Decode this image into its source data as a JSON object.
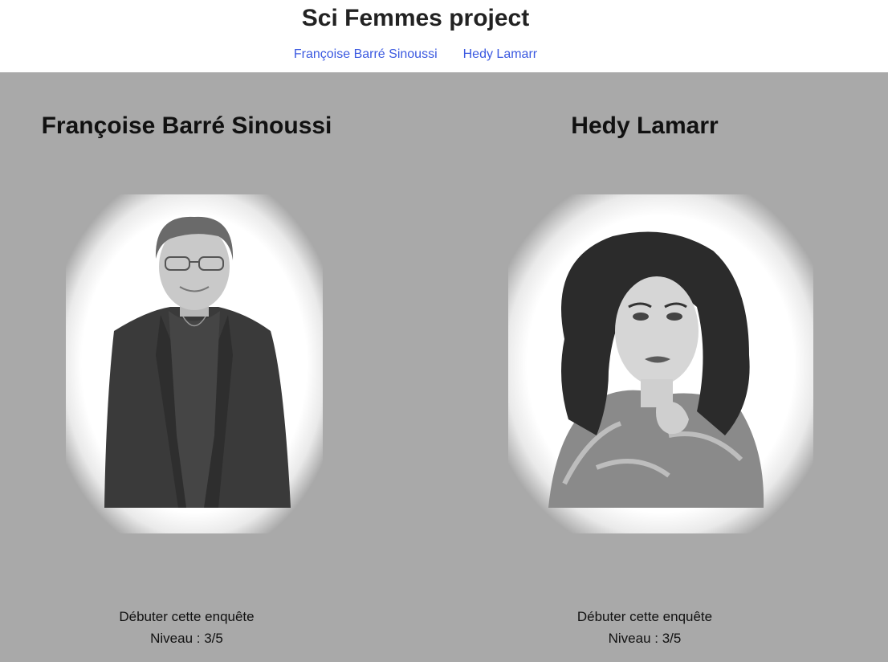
{
  "site": {
    "title": "Sci Femmes project"
  },
  "nav": {
    "items": [
      {
        "label": "Françoise Barré Sinoussi"
      },
      {
        "label": "Hedy Lamarr"
      }
    ]
  },
  "cards": [
    {
      "name": "Françoise Barré Sinoussi",
      "start_label": "Débuter cette enquête",
      "level_label": "Niveau : 3/5"
    },
    {
      "name": "Hedy Lamarr",
      "start_label": "Débuter cette enquête",
      "level_label": "Niveau : 3/5"
    }
  ],
  "colors": {
    "background": "#a9a9a9",
    "link": "#3b59e0",
    "header": "#ffffff"
  }
}
